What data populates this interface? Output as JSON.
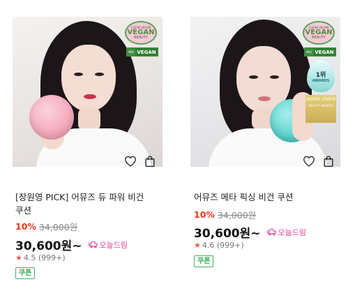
{
  "products": [
    {
      "name_line1": "[장원영 PICK] 어뮤즈 듀 파워 비건",
      "name_line2": "쿠션",
      "discount": "10%",
      "original_price": "34,000원",
      "sale_price": "30,600원~",
      "today_label": "오늘드림",
      "rating": "4.5 (999+)",
      "coupon": "쿠폰",
      "badges": {
        "vegan_top": "CLEAN VEGAN",
        "vegan_big": "VEGAN",
        "vegan_small": "BEAUTY",
        "vegan_rect": "VEGAN",
        "vegan_leaf": "eu"
      }
    },
    {
      "name_line1": "어뮤즈 메타 픽싱 비건 쿠션",
      "name_line2": "",
      "discount": "10%",
      "original_price": "34,000원",
      "sale_price": "30,600원~",
      "today_label": "오늘드림",
      "rating": "4.6 (999+)",
      "coupon": "쿠폰",
      "badges": {
        "vegan_top": "CLEAN VEGAN",
        "vegan_big": "VEGAN",
        "vegan_small": "BEAUTY",
        "vegan_rect": "VEGAN",
        "vegan_leaf": "eu",
        "award_rank": "1위",
        "award_word": "AWARDS",
        "mc_title": "marie claire",
        "mc_sub": "BEAUTY AWARDS"
      }
    }
  ],
  "colors": {
    "discount": "#e8361c",
    "today": "#e8459a",
    "coupon": "#2aa84a",
    "star": "#e85a4f"
  },
  "icons": [
    "heart-icon",
    "shopping-bag-icon",
    "today-delivery-icon",
    "star-icon"
  ]
}
